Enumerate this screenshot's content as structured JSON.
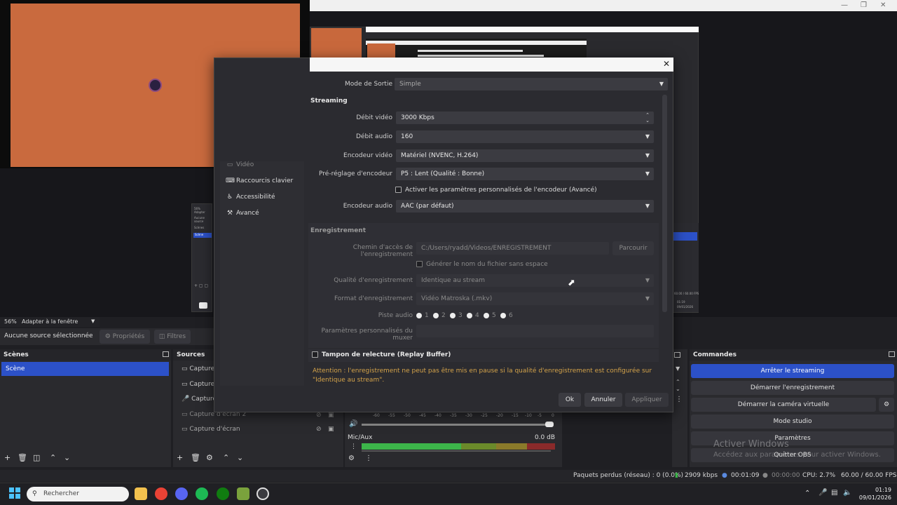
{
  "preview": {
    "zoom": "56%",
    "fit_label": "Adapter à la fenêtre",
    "no_source": "Aucune source sélectionnée",
    "properties_button": "Propriétés",
    "filters_button": "Filtres"
  },
  "mini_obs": {
    "zoom": "56%",
    "fit": "Adapter",
    "no_source": "Aucune source",
    "scenes": "Scènes",
    "scene_item": "Scène",
    "fps": "60.00 / 60.00 FPS",
    "time": "01:19",
    "date": "09/01/2026"
  },
  "scenes_panel": {
    "title": "Scènes",
    "items": [
      "Scène"
    ]
  },
  "sources_panel": {
    "title": "Sources",
    "items": [
      "Capture de",
      "Capture d'",
      "Capture au",
      "Capture d'écran 2",
      "Capture d'écran"
    ]
  },
  "mixer": {
    "scale": [
      "-60",
      "-55",
      "-50",
      "-45",
      "-40",
      "-35",
      "-30",
      "-25",
      "-20",
      "-15",
      "-10",
      "-5",
      "0"
    ],
    "channel_name": "Mic/Aux",
    "channel_db": "0.0 dB"
  },
  "commands_panel": {
    "title": "Commandes",
    "buttons": [
      "Arrêter le streaming",
      "Démarrer l'enregistrement",
      "Démarrer la caméra virtuelle",
      "Mode studio",
      "Paramètres",
      "Quitter OBS"
    ]
  },
  "dialog": {
    "sidebar": [
      {
        "label": "Vidéo",
        "icon": "monitor-icon"
      },
      {
        "label": "Raccourcis clavier",
        "icon": "keyboard-icon"
      },
      {
        "label": "Accessibilité",
        "icon": "accessibility-icon"
      },
      {
        "label": "Avancé",
        "icon": "wrench-icon"
      }
    ],
    "output_mode_label": "Mode de Sortie",
    "output_mode_value": "Simple",
    "streaming_title": "Streaming",
    "video_bitrate_label": "Débit vidéo",
    "video_bitrate_value": "3000 Kbps",
    "audio_bitrate_label": "Débit audio",
    "audio_bitrate_value": "160",
    "video_encoder_label": "Encodeur vidéo",
    "video_encoder_value": "Matériel (NVENC, H.264)",
    "encoder_preset_label": "Pré-réglage d'encodeur",
    "encoder_preset_value": "P5 : Lent (Qualité : Bonne)",
    "custom_encoder_label": "Activer les paramètres personnalisés de l'encodeur (Avancé)",
    "audio_encoder_label": "Encodeur audio",
    "audio_encoder_value": "AAC (par défaut)",
    "recording_title": "Enregistrement",
    "recording_path_label": "Chemin d'accès de l'enregistrement",
    "recording_path_value": "C:/Users/ryadd/Videos/ENREGISTREMENT",
    "browse_button": "Parcourir",
    "no_space_label": "Générer le nom du fichier sans espace",
    "recording_quality_label": "Qualité d'enregistrement",
    "recording_quality_value": "Identique au stream",
    "recording_format_label": "Format d'enregistrement",
    "recording_format_value": "Vidéo Matroska (.mkv)",
    "audio_track_label": "Piste audio",
    "audio_tracks": [
      "1",
      "2",
      "3",
      "4",
      "5",
      "6"
    ],
    "muxer_label": "Paramètres personnalisés du muxer",
    "replay_buffer_label": "Tampon de relecture (Replay Buffer)",
    "warning": "Attention : l'enregistrement ne peut pas être mis en pause si la qualité d'enregistrement est configurée sur \"Identique au stream\".",
    "ok_button": "Ok",
    "cancel_button": "Annuler",
    "apply_button": "Appliquer"
  },
  "watermark": {
    "line1": "Activer Windows",
    "line2": "Accédez aux paramètres pour activer Windows."
  },
  "statusbar": {
    "dropped": "Paquets perdus (réseau) : 0 (0.0%)",
    "bitrate": "2909 kbps",
    "stream_time": "00:01:09",
    "rec_time": "00:00:00",
    "cpu": "CPU: 2.7%",
    "fps": "60.00 / 60.00 FPS"
  },
  "taskbar": {
    "search_placeholder": "Rechercher",
    "time": "01:19",
    "date": "09/01/2026"
  },
  "colors": {
    "accent": "#2c51c8",
    "warning": "#d4a34a",
    "orange": "#c96a3e"
  }
}
